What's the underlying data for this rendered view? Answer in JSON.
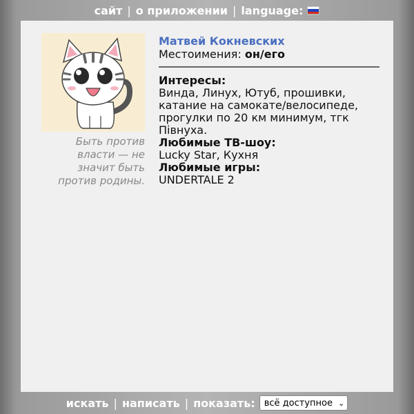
{
  "nav": {
    "site": "сайт",
    "about": "о приложении",
    "language": "language:",
    "flag_icon": "russian-flag-icon"
  },
  "profile": {
    "name": "Матвей Кокневских",
    "pronouns_label": "Местоимения:",
    "pronouns_value": "он/его",
    "avatar_icon": "cartoon-cat-avatar",
    "quote": "Быть против власти — не значит быть против родины.",
    "interests_label": "Интересы:",
    "interests_value": "Винда, Линух, Ютуб, прошивки, катание на самокате/велосипеде, прогулки по 20 км минимум, тгк Півнуха.",
    "tv_label": "Любимые ТВ-шоу:",
    "tv_value": "Lucky Star, Кухня",
    "games_label": "Любимые игры:",
    "games_value": "UNDERTALE 2"
  },
  "bottom": {
    "search": "искать",
    "write": "написать",
    "show_label": "показать:",
    "show_value": "всё доступное"
  },
  "colors": {
    "panel": "#f0f0f0",
    "name_link": "#4a6fc0",
    "quote": "#888888"
  }
}
